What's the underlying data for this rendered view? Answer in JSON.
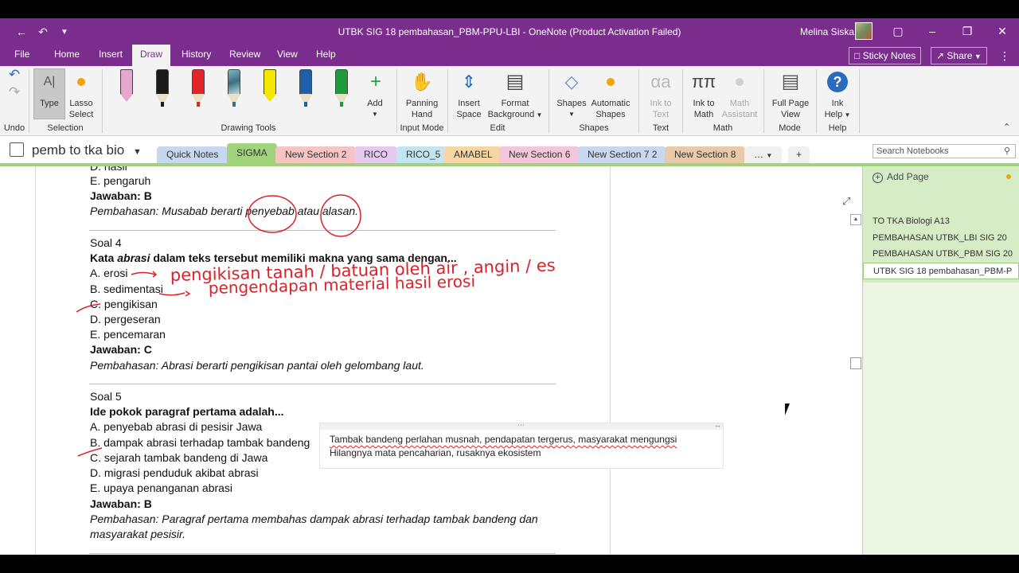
{
  "window": {
    "title": "UTBK SIG 18 pembahasan_PBM-PPU-LBI  -  OneNote (Product Activation Failed)",
    "user": "Melina Siska"
  },
  "menu": [
    "File",
    "Home",
    "Insert",
    "Draw",
    "History",
    "Review",
    "View",
    "Help"
  ],
  "menu_active": "Draw",
  "topright": {
    "sticky_notes": "Sticky Notes",
    "share": "Share"
  },
  "ribbon": {
    "undo": {
      "group": "Undo"
    },
    "type": "Type",
    "lasso": [
      "Lasso",
      "Select"
    ],
    "selection_group": "Selection",
    "drawing_tools_group": "Drawing Tools",
    "add": "Add",
    "panning": [
      "Panning",
      "Hand"
    ],
    "input_mode_group": "Input Mode",
    "insert_space": [
      "Insert",
      "Space"
    ],
    "format_bg": [
      "Format",
      "Background"
    ],
    "edit_group": "Edit",
    "shapes": "Shapes",
    "auto_shapes": [
      "Automatic",
      "Shapes"
    ],
    "shapes_group": "Shapes",
    "ink_to_text": [
      "Ink to",
      "Text"
    ],
    "text_group": "Text",
    "ink_to_math": [
      "Ink to",
      "Math"
    ],
    "math_assistant": [
      "Math",
      "Assistant"
    ],
    "math_group": "Math",
    "full_page": [
      "Full Page",
      "View"
    ],
    "mode_group": "Mode",
    "ink_help": [
      "Ink",
      "Help"
    ],
    "help_group": "Help",
    "pen_colors": [
      "#e6a7cf",
      "#1a1a1a",
      "#e3242b",
      "#7fb8c4",
      "#f5e600",
      "#1f5fa8",
      "#1e9a3b"
    ]
  },
  "notebook": {
    "name": "pemb to tka bio"
  },
  "sections": [
    {
      "label": "Quick Notes",
      "color": "#c7d7ef"
    },
    {
      "label": "SIGMA",
      "color": "#a0d47c"
    },
    {
      "label": "New Section 2",
      "color": "#f7c4c4"
    },
    {
      "label": "RICO",
      "color": "#e6c9ef"
    },
    {
      "label": "RICO_5",
      "color": "#c4e4f0"
    },
    {
      "label": "AMABEL",
      "color": "#f6d6a4"
    },
    {
      "label": "New Section 6",
      "color": "#f3c6d9"
    },
    {
      "label": "New Section 7 2",
      "color": "#c9d7ef"
    },
    {
      "label": "New Section 8",
      "color": "#e8c9a8"
    }
  ],
  "search_placeholder": "Search Notebooks",
  "page_panel": {
    "add_page": "Add Page",
    "pages": [
      "TO TKA Biologi A13",
      "PEMBAHASAN UTBK_LBI SIG 20",
      "PEMBAHASAN UTBK_PBM SIG 20",
      "UTBK SIG 18 pembahasan_PBM-P"
    ]
  },
  "content": {
    "partial_top": "D. hasil",
    "q3_e": "E. pengaruh",
    "q3_answer": "Jawaban: B",
    "q3_expl_a": "Pembahasan: Musabab berarti ",
    "q3_expl_b": "penyebab",
    "q3_expl_c": " atau ",
    "q3_expl_d": "alasan.",
    "soal4": "Soal 4",
    "q4_prompt_a": "Kata ",
    "q4_prompt_b": "abrasi",
    "q4_prompt_c": " dalam teks tersebut memiliki makna yang sama dengan...",
    "q4_opts": [
      "A. erosi",
      "B. sedimentasi",
      "C. pengikisan",
      "D. pergeseran",
      "E. pencemaran"
    ],
    "q4_answer": "Jawaban: C",
    "q4_expl": "Pembahasan: Abrasi berarti pengikisan pantai oleh gelombang laut.",
    "soal5": "Soal 5",
    "q5_prompt": "Ide pokok paragraf pertama adalah...",
    "q5_opts": [
      "A. penyebab abrasi di pesisir Jawa",
      "B. dampak abrasi terhadap tambak bandeng",
      "C. sejarah tambak bandeng di Jawa",
      "D. migrasi penduduk akibat abrasi",
      "E. upaya penanganan abrasi"
    ],
    "q5_answer": "Jawaban: B",
    "q5_expl_1": "Pembahasan: Paragraf pertama membahas dampak abrasi terhadap tambak bandeng dan",
    "q5_expl_2": "masyarakat pesisir."
  },
  "ink_notes": {
    "line1": "pengikisan tanah / batuan oleh air , angin / es",
    "line2": "pengendapan material hasil erosi"
  },
  "text_box": {
    "line1": "Tambak bandeng perlahan musnah, pendapatan tergerus, masyarakat mengungsi",
    "line2": "Hilangnya mata pencaharian, rusaknya ekosistem"
  },
  "colors": {
    "onenote_purple": "#7b2d8e",
    "ink_red": "#d8232a",
    "page_green": "#a0d47c"
  }
}
